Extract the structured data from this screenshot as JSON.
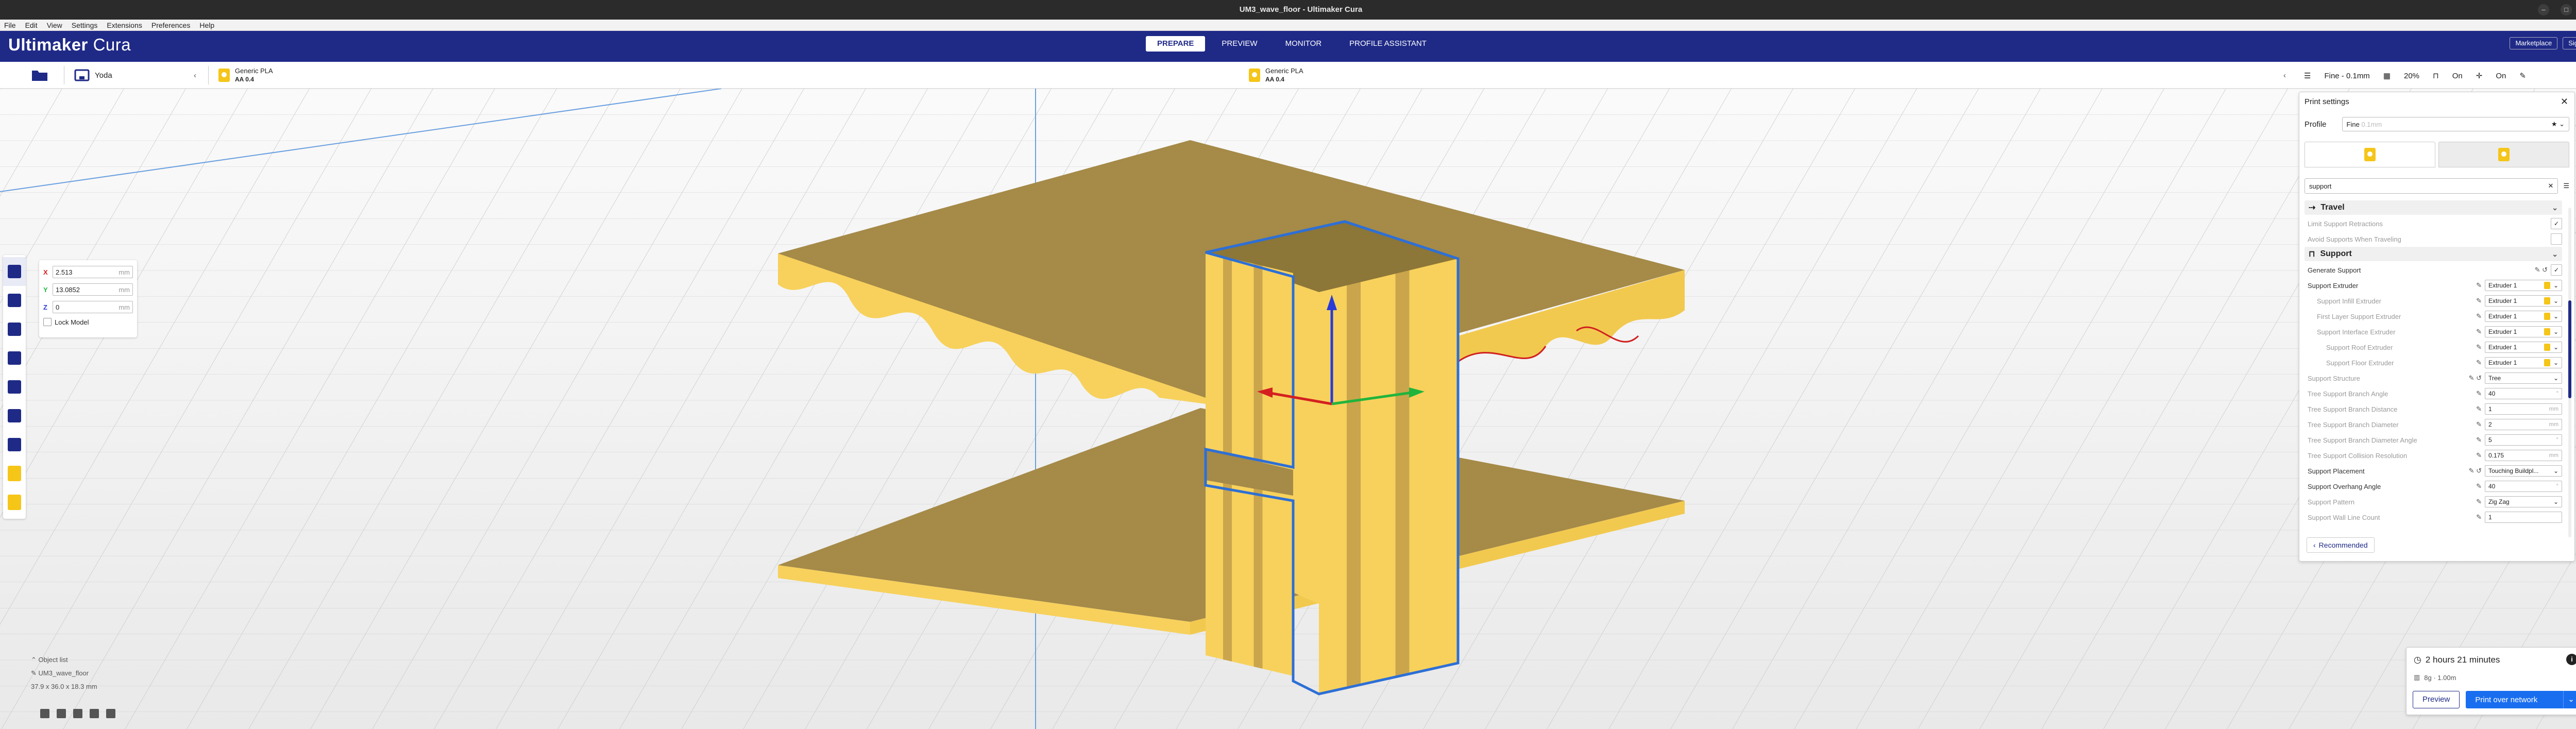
{
  "window": {
    "title": "UM3_wave_floor - Ultimaker Cura",
    "controls": [
      "–",
      "□",
      "✕"
    ]
  },
  "menu": [
    "File",
    "Edit",
    "View",
    "Settings",
    "Extensions",
    "Preferences",
    "Help"
  ],
  "header": {
    "logo_brand": "Ultimaker",
    "logo_product": "Cura",
    "stages": [
      "PREPARE",
      "PREVIEW",
      "MONITOR",
      "PROFILE ASSISTANT"
    ],
    "active_stage": "PREPARE",
    "marketplace_label": "Marketplace",
    "signin_label": "Sign in"
  },
  "machine_bar": {
    "printer": "Yoda",
    "extruder1": {
      "material": "Generic PLA",
      "nozzle": "AA 0.4"
    },
    "extruder2": {
      "material": "Generic PLA",
      "nozzle": "AA 0.4"
    }
  },
  "settings_summary": {
    "profile": "Fine - 0.1mm",
    "infill": "20%",
    "support": "On",
    "adhesion": "On"
  },
  "move_tool": {
    "x": "2.513",
    "y": "13.0852",
    "z": "0",
    "unit": "mm",
    "lock_label": "Lock Model"
  },
  "object_list": {
    "header": "Object list",
    "object_name": "UM3_wave_floor",
    "dimensions": "37.9 x 36.0 x 18.3 mm"
  },
  "print_settings": {
    "title": "Print settings",
    "profile_label": "Profile",
    "profile_value": "Fine",
    "profile_hint": "0.1mm",
    "search_value": "support",
    "travel": {
      "name": "Travel",
      "rows": [
        {
          "label": "Limit Support Retractions",
          "value": "✓"
        },
        {
          "label": "Avoid Supports When Traveling",
          "value": ""
        }
      ]
    },
    "support": {
      "name": "Support",
      "rows": [
        {
          "label": "Generate Support",
          "value": "✓"
        },
        {
          "label": "Support Extruder",
          "value": "Extruder 1"
        },
        {
          "label": "Support Infill Extruder",
          "value": "Extruder 1"
        },
        {
          "label": "First Layer Support Extruder",
          "value": "Extruder 1"
        },
        {
          "label": "Support Interface Extruder",
          "value": "Extruder 1"
        },
        {
          "label": "Support Roof Extruder",
          "value": "Extruder 1"
        },
        {
          "label": "Support Floor Extruder",
          "value": "Extruder 1"
        },
        {
          "label": "Support Structure",
          "value": "Tree"
        },
        {
          "label": "Tree Support Branch Angle",
          "value": "40",
          "unit": "°"
        },
        {
          "label": "Tree Support Branch Distance",
          "value": "1",
          "unit": "mm"
        },
        {
          "label": "Tree Support Branch Diameter",
          "value": "2",
          "unit": "mm"
        },
        {
          "label": "Tree Support Branch Diameter Angle",
          "value": "5",
          "unit": "°"
        },
        {
          "label": "Tree Support Collision Resolution",
          "value": "0.175",
          "unit": "mm"
        },
        {
          "label": "Support Placement",
          "value": "Touching Buildpl..."
        },
        {
          "label": "Support Overhang Angle",
          "value": "40",
          "unit": "°"
        },
        {
          "label": "Support Pattern",
          "value": "Zig Zag"
        },
        {
          "label": "Support Wall Line Count",
          "value": "1"
        }
      ]
    },
    "recommended_label": "Recommended"
  },
  "action_panel": {
    "time": "2 hours 21 minutes",
    "material": "8g · 1.00m",
    "preview_label": "Preview",
    "print_label": "Print over network"
  },
  "colors": {
    "header": "#1f2a87",
    "model_yellow": "#f7d15c",
    "model_shadow": "#a58a48",
    "accent_blue": "#196ef0"
  }
}
